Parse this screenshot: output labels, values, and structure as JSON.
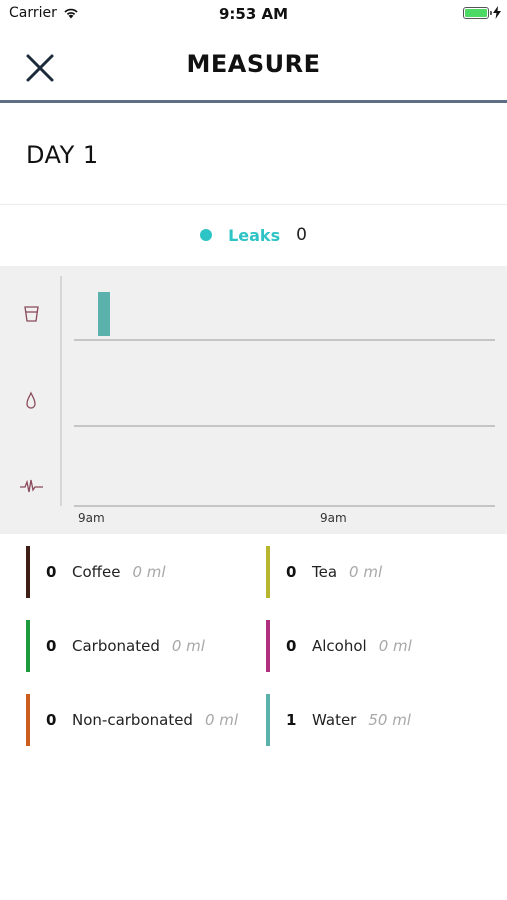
{
  "status": {
    "carrier": "Carrier",
    "time": "9:53 AM"
  },
  "nav": {
    "title": "MEASURE"
  },
  "day": {
    "title": "DAY 1"
  },
  "leaks": {
    "label": "Leaks",
    "count": "0",
    "color": "#2ec4c6"
  },
  "chart": {
    "x_ticks": [
      "9am",
      "9am"
    ],
    "row_icons": [
      "cup-icon",
      "drop-icon",
      "pulse-icon"
    ],
    "bar_color": "#5bb2ad"
  },
  "chart_data": {
    "type": "bar",
    "rows": [
      "drinks",
      "leaks",
      "urges"
    ],
    "x": [
      "9am"
    ],
    "series": [
      {
        "row": "drinks",
        "values": [
          1
        ]
      },
      {
        "row": "leaks",
        "values": [
          0
        ]
      },
      {
        "row": "urges",
        "values": [
          0
        ]
      }
    ]
  },
  "drinks": [
    {
      "count": "0",
      "name": "Coffee",
      "volume": "0 ml",
      "color": "#3d1f16"
    },
    {
      "count": "0",
      "name": "Tea",
      "volume": "0 ml",
      "color": "#b8b531"
    },
    {
      "count": "0",
      "name": "Carbonated",
      "volume": "0 ml",
      "color": "#1d9a3c"
    },
    {
      "count": "0",
      "name": "Alcohol",
      "volume": "0 ml",
      "color": "#b0307f"
    },
    {
      "count": "0",
      "name": "Non-carbonated",
      "volume": "0 ml",
      "color": "#cc5d1c"
    },
    {
      "count": "1",
      "name": "Water",
      "volume": "50 ml",
      "color": "#5bb2ad"
    }
  ]
}
